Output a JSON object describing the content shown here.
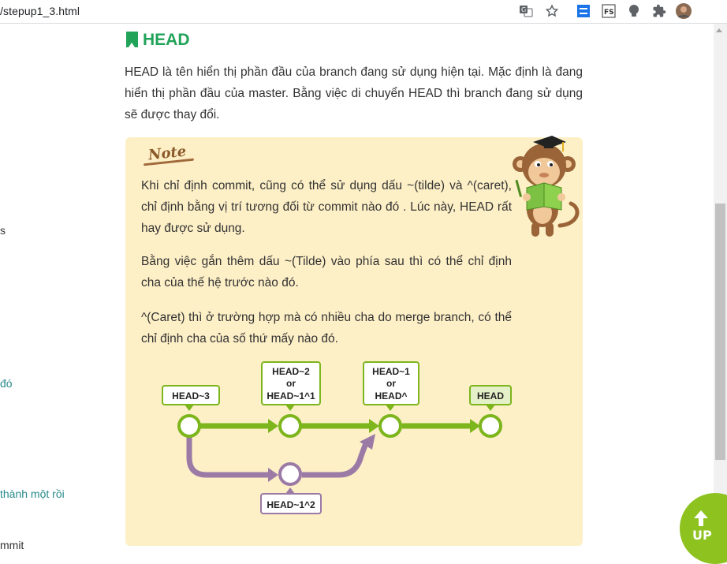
{
  "browser": {
    "url": "/stepup1_3.html",
    "icons": [
      "translate-icon",
      "bookmark-star-icon",
      "extension-s-icon",
      "extension-fs-icon",
      "extension-bulb-icon",
      "extensions-puzzle-icon",
      "profile-avatar"
    ]
  },
  "sidebar": {
    "fragments": [
      {
        "text": "s"
      },
      {
        "text": "đó"
      },
      {
        "text": "thành một rồi"
      },
      {
        "text": "mmit"
      }
    ]
  },
  "section": {
    "title": "HEAD",
    "intro": "HEAD là tên hiển thị phần đầu của branch đang sử dụng hiện tại. Mặc định là đang hiển thị phần đầu của master. Bằng việc di chuyển HEAD thì branch đang sử dụng sẽ được thay đổi."
  },
  "note": {
    "label": "Note",
    "paragraphs": [
      "Khi chỉ định commit, cũng có thể sử dụng dấu ~(tilde) và ^(caret), chỉ định bằng vị trí tương đối từ commit nào đó . Lúc này, HEAD rất hay được sử dụng.",
      "Bằng việc gắn thêm dấu ~(Tilde) vào phía sau thì có thể chỉ định cha của thế hệ trước nào đó.",
      "^(Caret) thì ở trường hợp mà có nhiều cha do merge branch, có thể chỉ định cha của số thứ mấy nào đó."
    ]
  },
  "diagram": {
    "labels": {
      "head3": "HEAD~3",
      "head2_l1": "HEAD~2",
      "head2_l2": "or",
      "head2_l3": "HEAD~1^1",
      "head1_l1": "HEAD~1",
      "head1_l2": "or",
      "head1_l3": "HEAD^",
      "head": "HEAD",
      "head1_2": "HEAD~1^2"
    },
    "colors": {
      "main": "#7cb51c",
      "branch": "#9b7aa6",
      "head_fill": "#e4f0c8"
    }
  },
  "up_button": {
    "label": "UP"
  }
}
